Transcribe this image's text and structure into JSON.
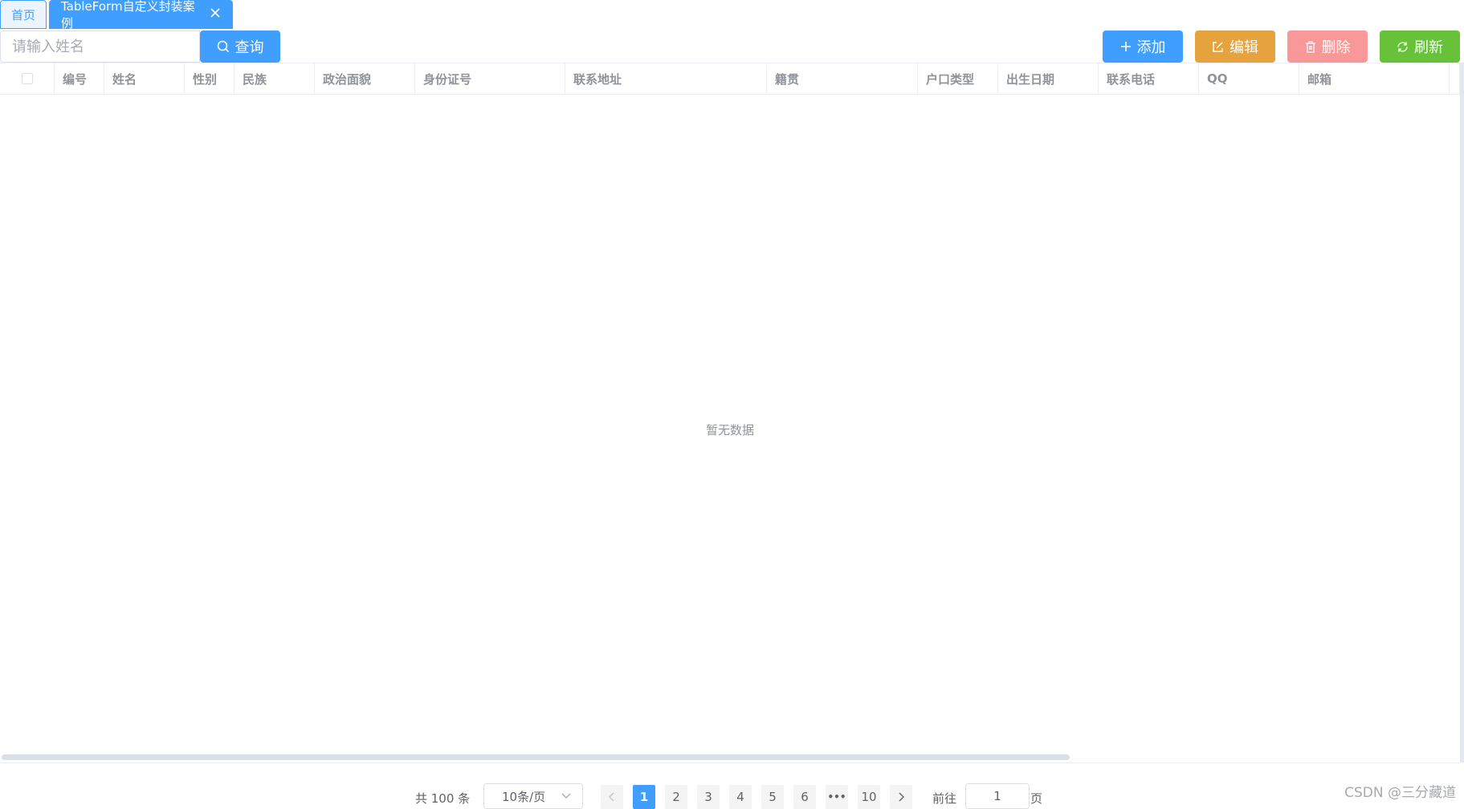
{
  "tabs": [
    {
      "label": "首页",
      "active": false
    },
    {
      "label": "TableForm自定义封装案例",
      "active": true
    }
  ],
  "search": {
    "placeholder": "请输入姓名",
    "value": "",
    "button_label": "查询",
    "button_icon": "search-icon"
  },
  "toolbar": {
    "add_label": "添加",
    "add_icon": "plus-icon",
    "add_color": "#409eff",
    "edit_label": "编辑",
    "edit_icon": "edit-icon",
    "edit_color": "#e6a23c",
    "delete_label": "删除",
    "delete_icon": "trash-icon",
    "delete_color": "#f89898",
    "refresh_label": "刷新",
    "refresh_icon": "refresh-icon",
    "refresh_color": "#67c23a"
  },
  "table": {
    "columns": [
      "编号",
      "姓名",
      "性别",
      "民族",
      "政治面貌",
      "身份证号",
      "联系地址",
      "籍贯",
      "户口类型",
      "出生日期",
      "联系电话",
      "QQ",
      "邮箱"
    ],
    "rows": [],
    "empty_text": "暂无数据"
  },
  "pagination": {
    "total_text": "共 100 条",
    "page_size": "10条/页",
    "pages": [
      "1",
      "2",
      "3",
      "4",
      "5",
      "6",
      "10"
    ],
    "ellipsis": "•••",
    "current_page": "1",
    "goto_label": "前往",
    "goto_value": "1",
    "goto_suffix": "页"
  },
  "watermark": "CSDN @三分藏道"
}
